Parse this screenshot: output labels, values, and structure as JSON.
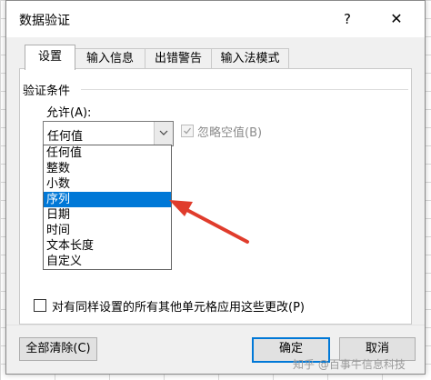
{
  "dialog": {
    "title": "数据验证",
    "help_glyph": "?",
    "close_glyph": "✕"
  },
  "tabs": [
    {
      "label": "设置"
    },
    {
      "label": "输入信息"
    },
    {
      "label": "出错警告"
    },
    {
      "label": "输入法模式"
    }
  ],
  "settings": {
    "section_title": "验证条件",
    "allow_label": "允许(A):",
    "allow_value": "任何值",
    "ignore_blank_label": "忽略空值(B)",
    "ignore_blank_checked": true,
    "allow_options": [
      "任何值",
      "整数",
      "小数",
      "序列",
      "日期",
      "时间",
      "文本长度",
      "自定义"
    ],
    "selected_option": "序列",
    "apply_all_label": "对有同样设置的所有其他单元格应用这些更改(P)",
    "apply_all_checked": false
  },
  "buttons": {
    "clear_all": "全部清除(C)",
    "ok": "确定",
    "cancel": "取消"
  },
  "watermark": "知乎 @百事牛信息科技",
  "colors": {
    "selection": "#0078d7",
    "annotation_arrow": "#e03c2c"
  },
  "icons": {
    "dropdown_arrow": "chevron-down-icon",
    "check": "check-icon",
    "close": "close-icon"
  }
}
